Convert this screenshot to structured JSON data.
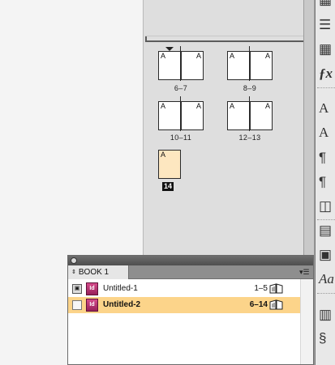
{
  "pages_panel": {
    "spreads": [
      {
        "label": "6–7",
        "left_prefix": "A",
        "right_prefix": "A"
      },
      {
        "label": "8–9",
        "left_prefix": "A",
        "right_prefix": "A"
      },
      {
        "label": "10–11",
        "left_prefix": "A",
        "right_prefix": "A"
      },
      {
        "label": "12–13",
        "left_prefix": "A",
        "right_prefix": "A"
      }
    ],
    "last_page": {
      "prefix": "A",
      "number": "14"
    }
  },
  "book_panel": {
    "tab_label": "BOOK 1",
    "documents": [
      {
        "name": "Untitled-1",
        "pages": "1–5",
        "selected": false
      },
      {
        "name": "Untitled-2",
        "pages": "6–14",
        "selected": true
      }
    ]
  },
  "icons": {
    "tool_strip": [
      "swatches-icon",
      "stroke-icon",
      "table-icon",
      "fx-icon",
      "character-icon",
      "character-styles-icon",
      "paragraph-icon",
      "paragraph-styles-icon",
      "text-wrap-icon",
      "align-icon",
      "pathfinder-icon",
      "glyphs-icon",
      "info-icon",
      "script-icon"
    ],
    "doc_icon_text": "Id"
  },
  "colors": {
    "selected_row": "#fcd48a",
    "page_fill_selected": "#fde7c0",
    "indesign_doc": "#c8336f"
  }
}
